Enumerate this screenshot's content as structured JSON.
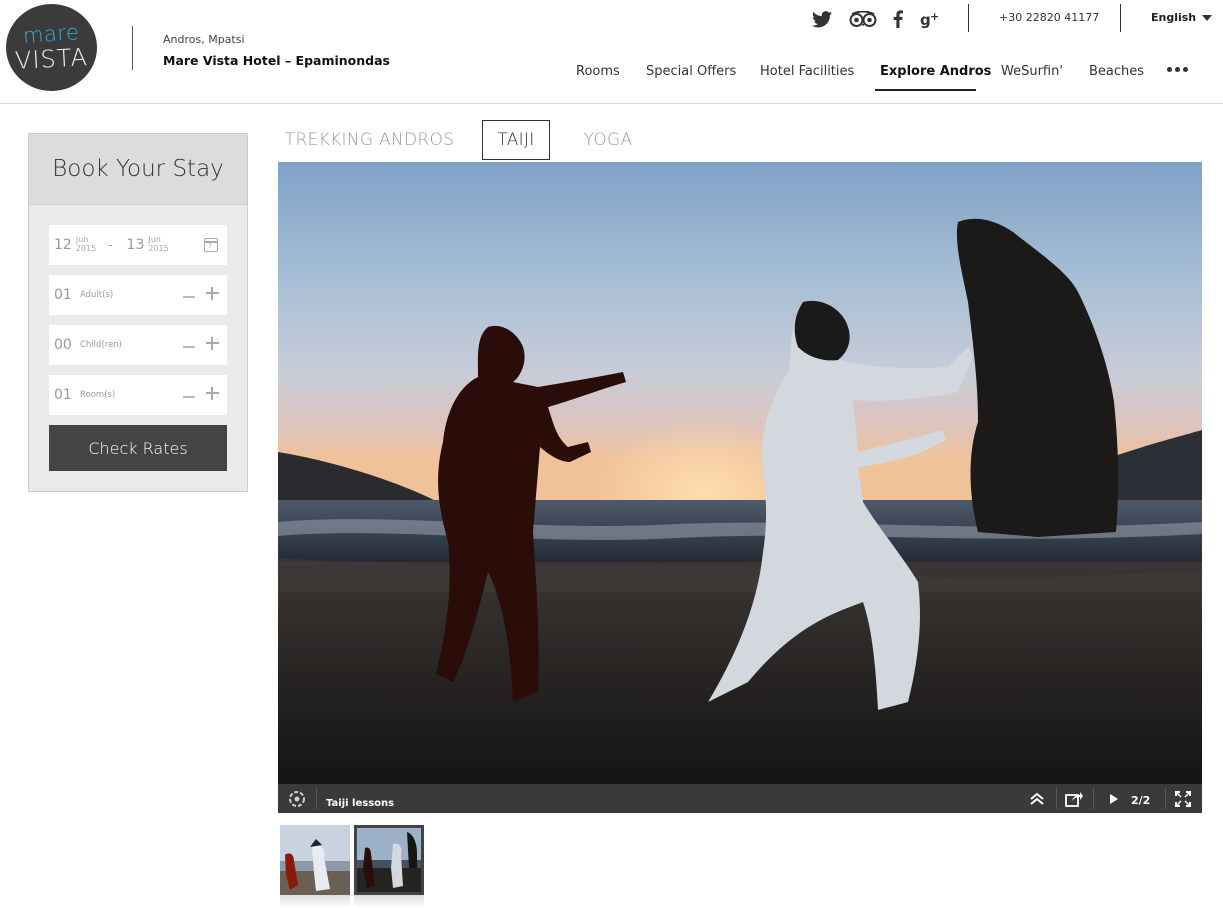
{
  "header": {
    "logo": {
      "line1": "mare",
      "line2": "VISTA"
    },
    "location": "Andros, Mpatsi",
    "hotel_name": "Mare Vista Hotel – Epaminondas",
    "social_icons": [
      "twitter-icon",
      "tripadvisor-icon",
      "facebook-icon",
      "google-plus-icon"
    ],
    "phone": "+30 22820 41177",
    "language": "English",
    "nav": [
      {
        "label": "Rooms",
        "active": false
      },
      {
        "label": "Special Offers",
        "active": false
      },
      {
        "label": "Hotel Facilities",
        "active": false
      },
      {
        "label": "Explore Andros",
        "active": true
      },
      {
        "label": "WeSurfin'",
        "active": false
      },
      {
        "label": "Beaches",
        "active": false
      }
    ],
    "more_icon": "more-dots-icon"
  },
  "booking": {
    "title": "Book Your Stay",
    "checkin": {
      "day": "12",
      "month": "Jun",
      "year": "2015"
    },
    "checkout": {
      "day": "13",
      "month": "Jun",
      "year": "2015"
    },
    "date_separator": "-",
    "adults": {
      "value": "01",
      "label": "Adult(s)"
    },
    "children": {
      "value": "00",
      "label": "Child(ren)"
    },
    "rooms": {
      "value": "01",
      "label": "Room(s)"
    },
    "check_button": "Check Rates",
    "calendar_icon_text": "7"
  },
  "tabs": [
    {
      "label": "TREKKING ANDROS",
      "active": false
    },
    {
      "label": "TAIJI",
      "active": true
    },
    {
      "label": "YOGA",
      "active": false
    }
  ],
  "gallery": {
    "caption": "Taiji lessons",
    "counter": "2/2",
    "thumbnails": 2,
    "active_thumbnail": 2,
    "icons": [
      "gallery-logo-icon",
      "collapse-up-icon",
      "share-icon",
      "play-icon",
      "fullscreen-icon"
    ]
  }
}
